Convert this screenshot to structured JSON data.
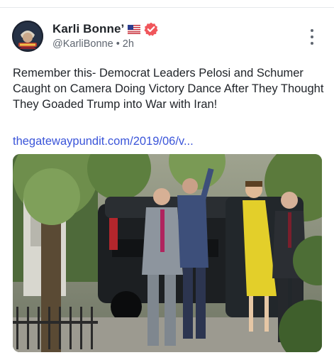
{
  "post": {
    "author_name": "Karli Bonne’",
    "handle": "@KarliBonne",
    "time": "2h",
    "text": "Remember this- Democrat Leaders Pelosi and Schumer Caught on Camera Doing Victory Dance After They Thought They Goaded Trump into War with Iran!",
    "link": "thegatewaypundit.com/2019/06/v..."
  },
  "icons": {
    "flag": "us-flag-icon",
    "verified": "verified-badge-icon",
    "more": "more-options-icon"
  },
  "colors": {
    "link": "#3b55d9",
    "verified_badge": "#f0565b",
    "text": "#1f2328",
    "secondary": "#5f6670"
  }
}
